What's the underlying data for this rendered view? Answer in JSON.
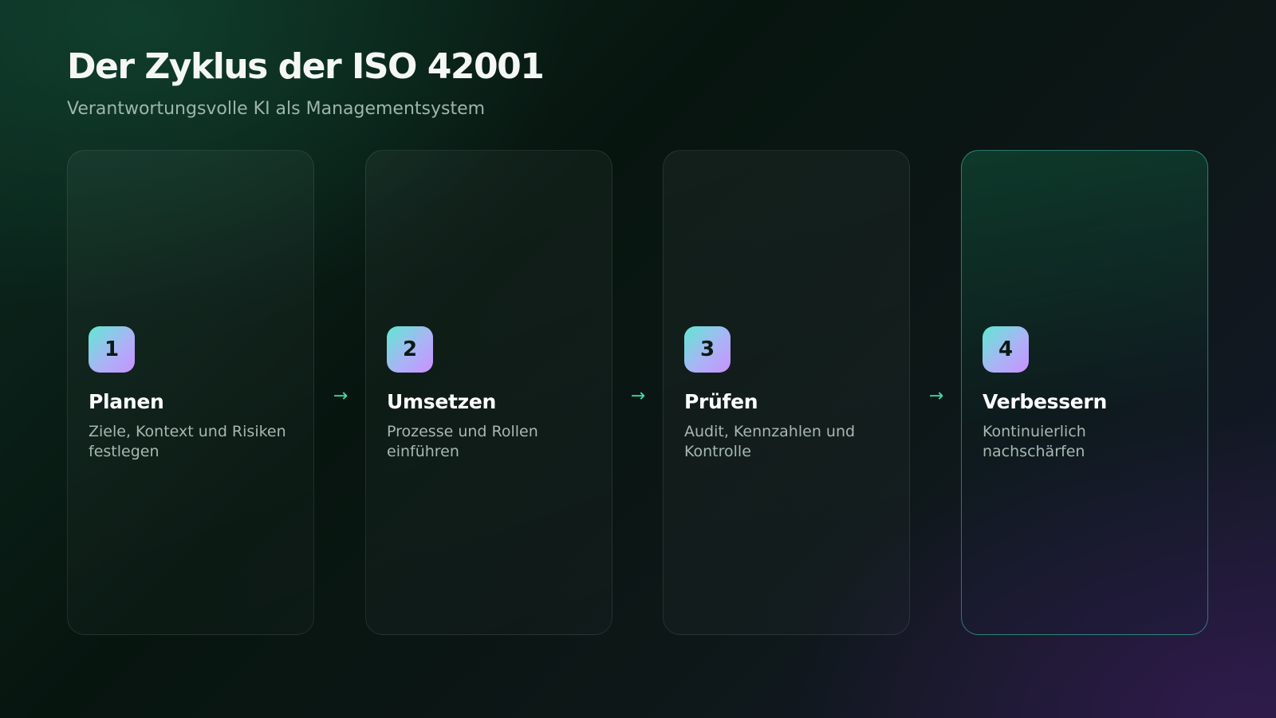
{
  "header": {
    "title": "Der Zyklus der ISO 42001",
    "subtitle": "Verantwortungsvolle KI als Managementsystem"
  },
  "steps": [
    {
      "number": "1",
      "title": "Planen",
      "description": "Ziele, Kontext und Risiken festlegen"
    },
    {
      "number": "2",
      "title": "Umsetzen",
      "description": "Prozesse und Rollen einführen"
    },
    {
      "number": "3",
      "title": "Prüfen",
      "description": "Audit, Kennzahlen und Kontrolle"
    },
    {
      "number": "4",
      "title": "Verbessern",
      "description": "Kontinuierlich nachschärfen"
    }
  ],
  "arrows": {
    "glyph": "→",
    "icon": "arrow-right-icon",
    "color": "#3fdcae"
  },
  "colors": {
    "badge_gradient_start": "#5fe8d2",
    "badge_gradient_end": "#c991ff",
    "highlight_border": "#3cc8aa"
  }
}
